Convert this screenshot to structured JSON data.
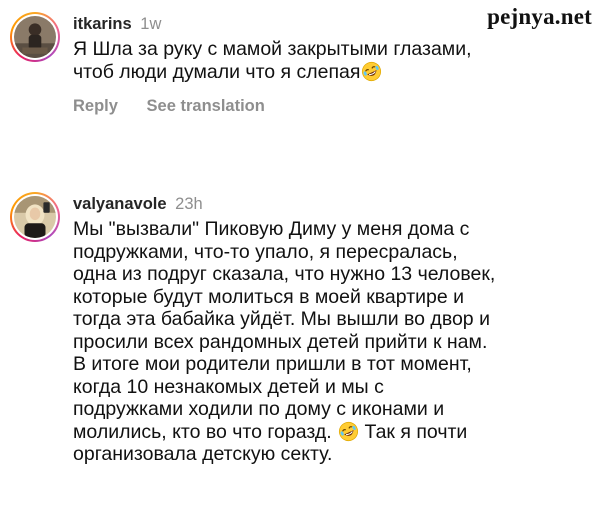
{
  "watermark": "pejnya.net",
  "comments": [
    {
      "username": "itkarins",
      "time": "1w",
      "lines": [
        "Я Шла за руку с мамой закрытыми глазами,",
        "чтоб люди думали что я слепая"
      ],
      "emoji": "rofl-emoji",
      "reply_label": "Reply",
      "translate_label": "See translation"
    },
    {
      "username": "valyanavole",
      "time": "23h",
      "lines": [
        "Мы \"вызвали\" Пиковую Диму у меня дома с",
        "подружками, что-то упало, я пересралась,",
        "одна из подруг сказала, что нужно 13 человек,",
        "которые будут молиться в моей квартире и",
        "тогда эта бабайка уйдёт. Мы вышли во двор и",
        "просили всех рандомных детей прийти к нам.",
        "В итоге мои родители пришли в тот момент,",
        "когда 10 незнакомых детей и мы с",
        "подружками ходили по дому с иконами и",
        "молились, кто во что горазд.",
        "организовала детскую секту."
      ],
      "line10_tail": "Так я почти",
      "emoji": "rofl-emoji"
    }
  ]
}
